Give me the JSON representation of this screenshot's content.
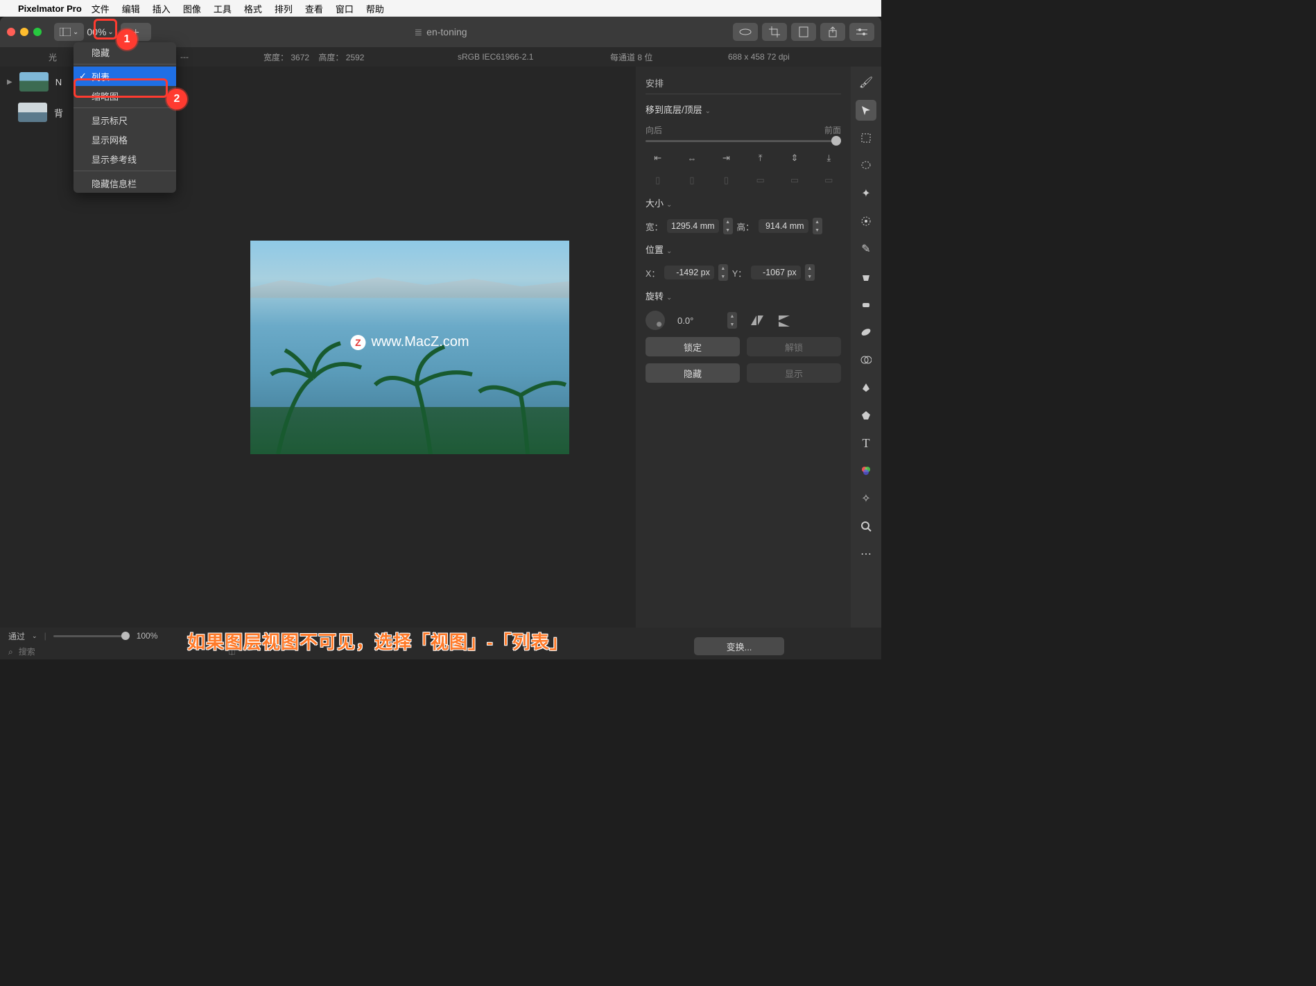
{
  "menubar": {
    "app": "Pixelmator Pro",
    "items": [
      "文件",
      "编辑",
      "插入",
      "图像",
      "工具",
      "格式",
      "排列",
      "查看",
      "窗口",
      "帮助"
    ]
  },
  "toolbar": {
    "zoom": "00%",
    "chev": "⌄",
    "title_icon": "≣",
    "title": "en-toning"
  },
  "infobar": {
    "layers_label_trunc": "光",
    "dash": "---",
    "width_label": "宽度：",
    "width_val": "3672",
    "height_label": "高度：",
    "height_val": "2592",
    "colorspace": "sRGB IEC61966-2.1",
    "bits": "每通道 8 位",
    "dims_dpi": "688 x 458 72 dpi"
  },
  "layers": {
    "row1": "N",
    "row2": "背"
  },
  "dropdown": {
    "hide_trunc": "隐藏",
    "list": "列表",
    "thumb": "缩略图",
    "rulers": "显示标尺",
    "grid": "显示网格",
    "guides": "显示参考线",
    "infobar": "隐藏信息栏"
  },
  "inspector": {
    "arrange": "安排",
    "movebg": "移到底层/顶层",
    "back": "向后",
    "front": "前面",
    "size": "大小",
    "w_label": "宽：",
    "w_val": "1295.4 mm",
    "h_label": "高：",
    "h_val": "914.4 mm",
    "pos": "位置",
    "x_label": "X：",
    "x_val": "-1492 px",
    "y_label": "Y：",
    "y_val": "-1067 px",
    "rotate": "旋转",
    "rot_val": "0.0°",
    "lock": "锁定",
    "unlock": "解锁",
    "hide": "隐藏",
    "show": "显示",
    "transform": "变换..."
  },
  "bottom": {
    "blend": "通过",
    "opacity": "100%",
    "search_icon": "⌕",
    "search_ph": "搜索",
    "levels_icon": "⎅"
  },
  "watermark": "www.MacZ.com",
  "wm_badge": "Z",
  "annot": {
    "n1": "1",
    "n2": "2"
  },
  "caption": "如果图层视图不可见，选择「视图」-「列表」"
}
